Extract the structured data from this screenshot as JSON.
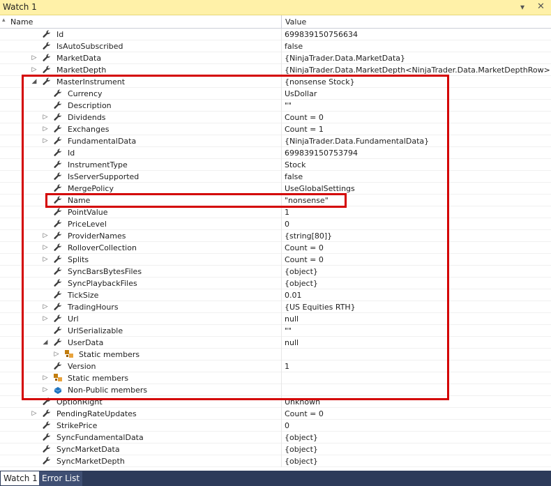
{
  "window": {
    "title": "Watch 1",
    "dropdown_icon": "chevron-down-icon",
    "close_icon": "close-icon"
  },
  "columns": {
    "name": "Name",
    "value": "Value"
  },
  "rows": [
    {
      "level": 2,
      "exp": "",
      "icon": "wrench",
      "name": "Id",
      "value": "699839150756634"
    },
    {
      "level": 2,
      "exp": "",
      "icon": "wrench",
      "name": "IsAutoSubscribed",
      "value": "false"
    },
    {
      "level": 2,
      "exp": "closed",
      "icon": "wrench",
      "name": "MarketData",
      "value": "{NinjaTrader.Data.MarketData}"
    },
    {
      "level": 2,
      "exp": "closed",
      "icon": "wrench",
      "name": "MarketDepth",
      "value": "{NinjaTrader.Data.MarketDepth<NinjaTrader.Data.MarketDepthRow>}"
    },
    {
      "level": 2,
      "exp": "open",
      "icon": "wrench",
      "name": "MasterInstrument",
      "value": "{nonsense Stock}"
    },
    {
      "level": 3,
      "exp": "",
      "icon": "wrench",
      "name": "Currency",
      "value": "UsDollar"
    },
    {
      "level": 3,
      "exp": "",
      "icon": "wrench",
      "name": "Description",
      "value": "\"\""
    },
    {
      "level": 3,
      "exp": "closed",
      "icon": "wrench",
      "name": "Dividends",
      "value": "Count = 0"
    },
    {
      "level": 3,
      "exp": "closed",
      "icon": "wrench",
      "name": "Exchanges",
      "value": "Count = 1"
    },
    {
      "level": 3,
      "exp": "closed",
      "icon": "wrench",
      "name": "FundamentalData",
      "value": "{NinjaTrader.Data.FundamentalData}"
    },
    {
      "level": 3,
      "exp": "",
      "icon": "wrench",
      "name": "Id",
      "value": "699839150753794"
    },
    {
      "level": 3,
      "exp": "",
      "icon": "wrench",
      "name": "InstrumentType",
      "value": "Stock"
    },
    {
      "level": 3,
      "exp": "",
      "icon": "wrench",
      "name": "IsServerSupported",
      "value": "false"
    },
    {
      "level": 3,
      "exp": "",
      "icon": "wrench",
      "name": "MergePolicy",
      "value": "UseGlobalSettings"
    },
    {
      "level": 3,
      "exp": "",
      "icon": "wrench",
      "name": "Name",
      "value": "\"nonsense\""
    },
    {
      "level": 3,
      "exp": "",
      "icon": "wrench",
      "name": "PointValue",
      "value": "1"
    },
    {
      "level": 3,
      "exp": "",
      "icon": "wrench",
      "name": "PriceLevel",
      "value": "0"
    },
    {
      "level": 3,
      "exp": "closed",
      "icon": "wrench",
      "name": "ProviderNames",
      "value": "{string[80]}"
    },
    {
      "level": 3,
      "exp": "closed",
      "icon": "wrench",
      "name": "RolloverCollection",
      "value": "Count = 0"
    },
    {
      "level": 3,
      "exp": "closed",
      "icon": "wrench",
      "name": "Splits",
      "value": "Count = 0"
    },
    {
      "level": 3,
      "exp": "",
      "icon": "wrench",
      "name": "SyncBarsBytesFiles",
      "value": "{object}"
    },
    {
      "level": 3,
      "exp": "",
      "icon": "wrench",
      "name": "SyncPlaybackFiles",
      "value": "{object}"
    },
    {
      "level": 3,
      "exp": "",
      "icon": "wrench",
      "name": "TickSize",
      "value": "0.01"
    },
    {
      "level": 3,
      "exp": "closed",
      "icon": "wrench",
      "name": "TradingHours",
      "value": "{US Equities RTH}"
    },
    {
      "level": 3,
      "exp": "closed",
      "icon": "wrench",
      "name": "Url",
      "value": "null"
    },
    {
      "level": 3,
      "exp": "",
      "icon": "wrench",
      "name": "UrlSerializable",
      "value": "\"\""
    },
    {
      "level": 3,
      "exp": "open",
      "icon": "wrench",
      "name": "UserData",
      "value": "null"
    },
    {
      "level": 4,
      "exp": "closed",
      "icon": "static",
      "name": "Static members",
      "value": ""
    },
    {
      "level": 3,
      "exp": "",
      "icon": "wrench",
      "name": "Version",
      "value": "1"
    },
    {
      "level": 3,
      "exp": "closed",
      "icon": "static",
      "name": "Static members",
      "value": ""
    },
    {
      "level": 3,
      "exp": "closed",
      "icon": "nonpublic",
      "name": "Non-Public members",
      "value": ""
    },
    {
      "level": 2,
      "exp": "",
      "icon": "wrench",
      "name": "OptionRight",
      "value": "Unknown"
    },
    {
      "level": 2,
      "exp": "closed",
      "icon": "wrench",
      "name": "PendingRateUpdates",
      "value": "Count = 0"
    },
    {
      "level": 2,
      "exp": "",
      "icon": "wrench",
      "name": "StrikePrice",
      "value": "0"
    },
    {
      "level": 2,
      "exp": "",
      "icon": "wrench",
      "name": "SyncFundamentalData",
      "value": "{object}"
    },
    {
      "level": 2,
      "exp": "",
      "icon": "wrench",
      "name": "SyncMarketData",
      "value": "{object}"
    },
    {
      "level": 2,
      "exp": "",
      "icon": "wrench",
      "name": "SyncMarketDepth",
      "value": "{object}"
    }
  ],
  "tabs": [
    {
      "label": "Watch 1",
      "active": true
    },
    {
      "label": "Error List",
      "active": false
    }
  ],
  "colors": {
    "highlight_border": "#d40000",
    "titlebar": "#fff1a8",
    "tabbar": "#2d3b5a"
  }
}
